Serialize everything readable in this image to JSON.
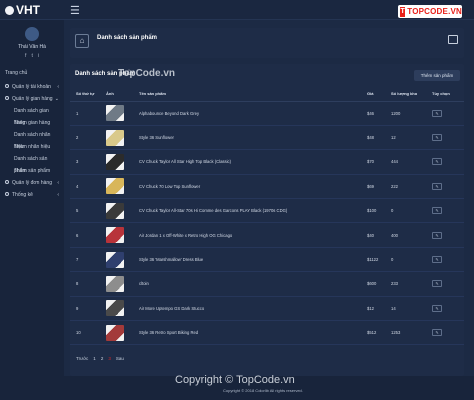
{
  "app": {
    "logo": "VHT",
    "menu_icon": "hamburger-icon",
    "brand": "TOPCODE.VN",
    "brand_icon": "T"
  },
  "sidebar": {
    "user_name": "Thái Văn Hà",
    "social": [
      "f",
      "t",
      "i"
    ],
    "home": "Trang chủ",
    "items": [
      {
        "label": "Quản lý tài khoản",
        "caret": "‹",
        "sub": false
      },
      {
        "label": "Quản lý gian hàng",
        "caret": "⌄",
        "sub": false
      },
      {
        "label": "Danh sách gian hàng",
        "sub": true
      },
      {
        "label": "Thêm gian hàng",
        "sub": true
      },
      {
        "label": "Danh sách nhãn hiệu",
        "sub": true
      },
      {
        "label": "Thêm nhãn hiệu",
        "sub": true
      },
      {
        "label": "Danh sách sản phẩm",
        "sub": true
      },
      {
        "label": "Thêm sản phẩm",
        "sub": true
      },
      {
        "label": "Quản lý đơn hàng",
        "caret": "‹",
        "sub": false
      },
      {
        "label": "Thống kê",
        "caret": "‹",
        "sub": false
      }
    ]
  },
  "header": {
    "title": "Danh sách sản phẩm"
  },
  "products": {
    "title": "Danh sách sản phẩm",
    "add_button": "Thêm sản phẩm",
    "columns": [
      "Số thứ tự",
      "Ảnh",
      "Tên sản phẩm",
      "Giá",
      "Số lượng kho",
      "Tùy chọn"
    ],
    "rows": [
      {
        "no": "1",
        "name": "Alphabounce Beyond Dark Grey",
        "price": "$46",
        "stock": "1200",
        "img": "#6f7a86"
      },
      {
        "no": "2",
        "name": "Style 36 Sunflower",
        "price": "$48",
        "stock": "12",
        "img": "#d9c98a"
      },
      {
        "no": "3",
        "name": "CV Chuck Taylor All Star High Top Black (Classic)",
        "price": "$70",
        "stock": "444",
        "img": "#2b2b2b"
      },
      {
        "no": "4",
        "name": "CV Chuck 70 Low Top Sunflower",
        "price": "$69",
        "stock": "222",
        "img": "#d8b65a"
      },
      {
        "no": "5",
        "name": "CV Chuck Taylor All-Star 70s Hi Comme des Garcons PLAY Black (1970s CDG)",
        "price": "$100",
        "stock": "0",
        "img": "#3a3a3a"
      },
      {
        "no": "6",
        "name": "Air Jordan 1 x Off-White x Retro High OG Chicago",
        "price": "$40",
        "stock": "400",
        "img": "#b8333a"
      },
      {
        "no": "7",
        "name": "Style 36 'Marshmallow' Dress Blue",
        "price": "$1122",
        "stock": "0",
        "img": "#2f3f6e"
      },
      {
        "no": "8",
        "name": "cltoin",
        "price": "$600",
        "stock": "233",
        "img": "#8d8d8d"
      },
      {
        "no": "9",
        "name": "Air More Uptempo GS Dark Stucco",
        "price": "$12",
        "stock": "14",
        "img": "#4a4a4a"
      },
      {
        "no": "10",
        "name": "Style 36 Retro Sport Biking Red",
        "price": "$512",
        "stock": "1253",
        "img": "#a33a3a"
      }
    ],
    "edit_label": "✎"
  },
  "pagination": {
    "prev": "Trước",
    "pages": [
      "1",
      "2",
      "3"
    ],
    "current": "3",
    "next": "Sau"
  },
  "watermarks": {
    "top": "TopCode.vn",
    "bottom": "Copyright © TopCode.vn"
  },
  "footer": {
    "copyright": "Copyright © 2018 Colorlib All rights reserved."
  }
}
